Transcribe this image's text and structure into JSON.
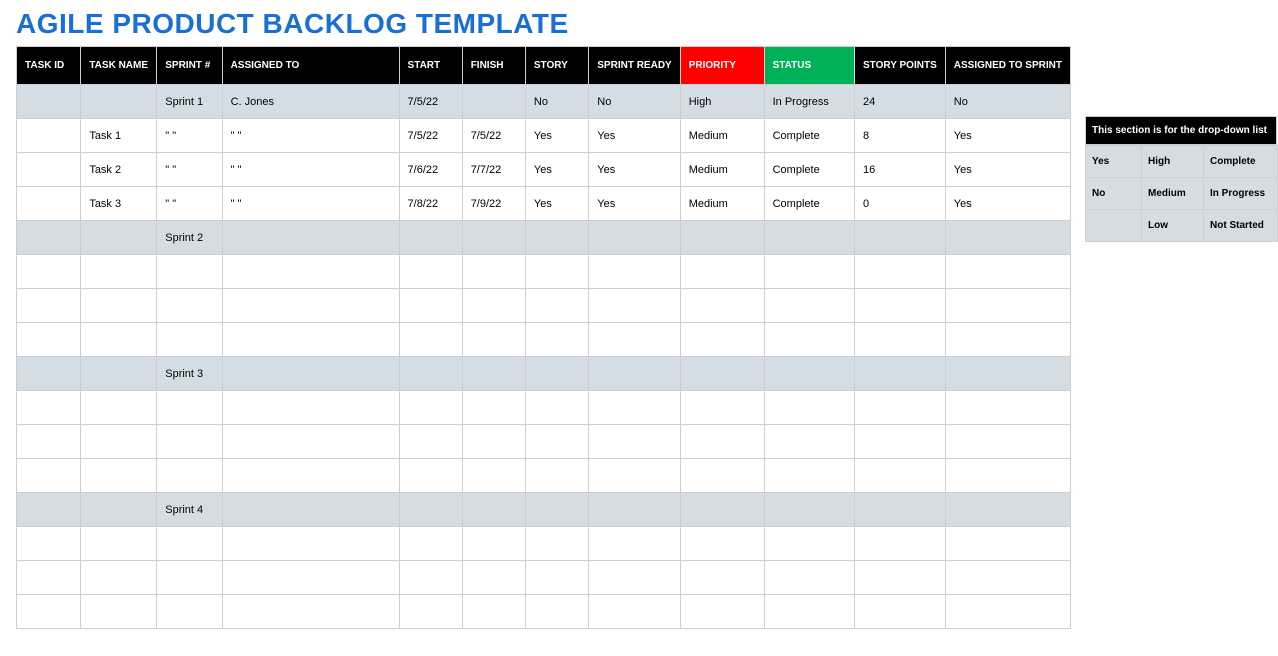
{
  "title": "AGILE PRODUCT BACKLOG TEMPLATE",
  "headers": {
    "task_id": "TASK ID",
    "task_name": "TASK NAME",
    "sprint_no": "SPRINT #",
    "assigned_to": "ASSIGNED TO",
    "start": "START",
    "finish": "FINISH",
    "story": "STORY",
    "sprint_ready": "SPRINT READY",
    "priority": "PRIORITY",
    "status": "STATUS",
    "story_points": "STORY POINTS",
    "assigned_to_sprint": "ASSIGNED TO SPRINT"
  },
  "rows": [
    {
      "type": "sprint",
      "task_id": "",
      "task_name": "",
      "sprint": "Sprint 1",
      "assigned": "C. Jones",
      "start": "7/5/22",
      "finish": "",
      "story": "No",
      "ready": "No",
      "priority": "High",
      "status": "In Progress",
      "points": "24",
      "asprint": "No"
    },
    {
      "type": "task",
      "task_id": "",
      "task_name": "Task 1",
      "sprint": "\" \"",
      "assigned": "\" \"",
      "start": "7/5/22",
      "finish": "7/5/22",
      "story": "Yes",
      "ready": "Yes",
      "priority": "Medium",
      "status": "Complete",
      "points": "8",
      "asprint": "Yes"
    },
    {
      "type": "task",
      "task_id": "",
      "task_name": "Task 2",
      "sprint": "\" \"",
      "assigned": "\" \"",
      "start": "7/6/22",
      "finish": "7/7/22",
      "story": "Yes",
      "ready": "Yes",
      "priority": "Medium",
      "status": "Complete",
      "points": "16",
      "asprint": "Yes"
    },
    {
      "type": "task",
      "task_id": "",
      "task_name": "Task 3",
      "sprint": "\" \"",
      "assigned": "\" \"",
      "start": "7/8/22",
      "finish": "7/9/22",
      "story": "Yes",
      "ready": "Yes",
      "priority": "Medium",
      "status": "Complete",
      "points": "0",
      "asprint": "Yes"
    },
    {
      "type": "sprint",
      "task_id": "",
      "task_name": "",
      "sprint": "Sprint 2",
      "assigned": "",
      "start": "",
      "finish": "",
      "story": "",
      "ready": "",
      "priority": "",
      "status": "",
      "points": "",
      "asprint": ""
    },
    {
      "type": "task",
      "task_id": "",
      "task_name": "",
      "sprint": "",
      "assigned": "",
      "start": "",
      "finish": "",
      "story": "",
      "ready": "",
      "priority": "",
      "status": "",
      "points": "",
      "asprint": ""
    },
    {
      "type": "task",
      "task_id": "",
      "task_name": "",
      "sprint": "",
      "assigned": "",
      "start": "",
      "finish": "",
      "story": "",
      "ready": "",
      "priority": "",
      "status": "",
      "points": "",
      "asprint": ""
    },
    {
      "type": "task",
      "task_id": "",
      "task_name": "",
      "sprint": "",
      "assigned": "",
      "start": "",
      "finish": "",
      "story": "",
      "ready": "",
      "priority": "",
      "status": "",
      "points": "",
      "asprint": ""
    },
    {
      "type": "sprint",
      "task_id": "",
      "task_name": "",
      "sprint": "Sprint 3",
      "assigned": "",
      "start": "",
      "finish": "",
      "story": "",
      "ready": "",
      "priority": "",
      "status": "",
      "points": "",
      "asprint": ""
    },
    {
      "type": "task",
      "task_id": "",
      "task_name": "",
      "sprint": "",
      "assigned": "",
      "start": "",
      "finish": "",
      "story": "",
      "ready": "",
      "priority": "",
      "status": "",
      "points": "",
      "asprint": ""
    },
    {
      "type": "task",
      "task_id": "",
      "task_name": "",
      "sprint": "",
      "assigned": "",
      "start": "",
      "finish": "",
      "story": "",
      "ready": "",
      "priority": "",
      "status": "",
      "points": "",
      "asprint": ""
    },
    {
      "type": "task",
      "task_id": "",
      "task_name": "",
      "sprint": "",
      "assigned": "",
      "start": "",
      "finish": "",
      "story": "",
      "ready": "",
      "priority": "",
      "status": "",
      "points": "",
      "asprint": ""
    },
    {
      "type": "sprint",
      "task_id": "",
      "task_name": "",
      "sprint": "Sprint 4",
      "assigned": "",
      "start": "",
      "finish": "",
      "story": "",
      "ready": "",
      "priority": "",
      "status": "",
      "points": "",
      "asprint": ""
    },
    {
      "type": "task",
      "task_id": "",
      "task_name": "",
      "sprint": "",
      "assigned": "",
      "start": "",
      "finish": "",
      "story": "",
      "ready": "",
      "priority": "",
      "status": "",
      "points": "",
      "asprint": ""
    },
    {
      "type": "task",
      "task_id": "",
      "task_name": "",
      "sprint": "",
      "assigned": "",
      "start": "",
      "finish": "",
      "story": "",
      "ready": "",
      "priority": "",
      "status": "",
      "points": "",
      "asprint": ""
    },
    {
      "type": "task",
      "task_id": "",
      "task_name": "",
      "sprint": "",
      "assigned": "",
      "start": "",
      "finish": "",
      "story": "",
      "ready": "",
      "priority": "",
      "status": "",
      "points": "",
      "asprint": ""
    }
  ],
  "legend": {
    "title": "This section is for the drop-down list",
    "yesno": [
      "Yes",
      "No",
      ""
    ],
    "priority": [
      "High",
      "Medium",
      "Low"
    ],
    "status": [
      "Complete",
      "In Progress",
      "Not Started"
    ]
  }
}
